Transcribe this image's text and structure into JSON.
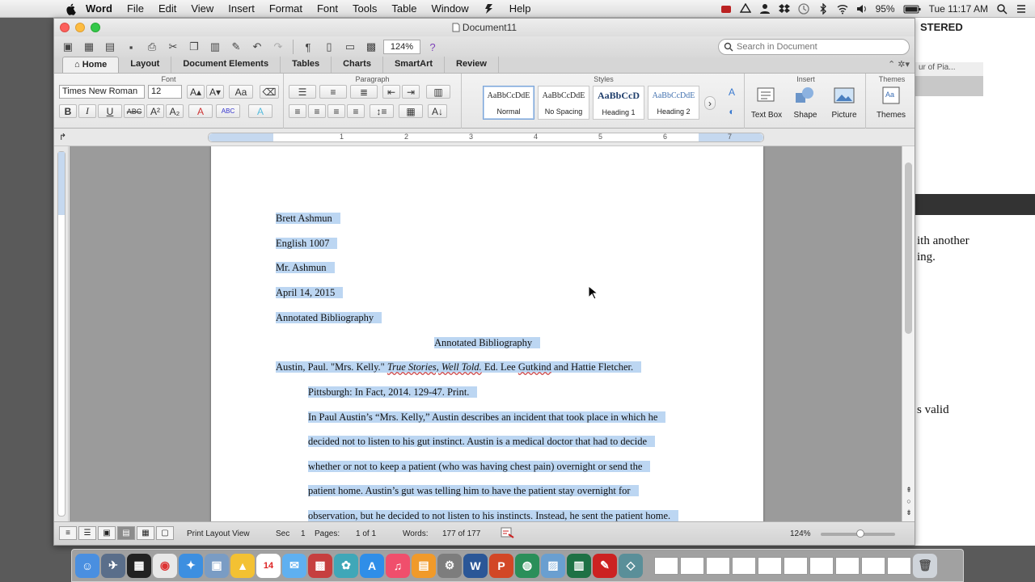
{
  "menubar": {
    "app": "Word",
    "items": [
      "File",
      "Edit",
      "View",
      "Insert",
      "Format",
      "Font",
      "Tools",
      "Table",
      "Window",
      "Help"
    ],
    "battery": "95%",
    "clock": "Tue 11:17 AM"
  },
  "window": {
    "title": "Document11"
  },
  "toolbar": {
    "zoom": "124%",
    "search_placeholder": "Search in Document"
  },
  "ribbon_tabs": [
    "Home",
    "Layout",
    "Document Elements",
    "Tables",
    "Charts",
    "SmartArt",
    "Review"
  ],
  "ribbon": {
    "font_group": "Font",
    "paragraph_group": "Paragraph",
    "styles_group": "Styles",
    "insert_group": "Insert",
    "themes_group": "Themes",
    "font_name": "Times New Roman",
    "font_size": "12",
    "styles": [
      {
        "preview": "AaBbCcDdE",
        "name": "Normal"
      },
      {
        "preview": "AaBbCcDdE",
        "name": "No Spacing"
      },
      {
        "preview": "AaBbCcD",
        "name": "Heading 1"
      },
      {
        "preview": "AaBbCcDdE",
        "name": "Heading 2"
      }
    ],
    "insert_items": [
      "Text Box",
      "Shape",
      "Picture"
    ],
    "themes_label": "Themes"
  },
  "ruler": {
    "numbers": [
      "1",
      "2",
      "3",
      "4",
      "5",
      "6",
      "7"
    ]
  },
  "document": {
    "lines": [
      "Brett Ashmun",
      "English 1007",
      "Mr. Ashmun",
      "April 14, 2015",
      "Annotated Bibliography",
      "Annotated Bibliography"
    ],
    "citation": {
      "author": "Austin, Paul. \"Mrs. Kelly.\" ",
      "book": "True Stories, Well Told.",
      "ed_prefix": " Ed. Lee ",
      "editor": "Gutkind",
      "ed_suffix": " and Hattie Fletcher.",
      "publisher": "Pittsburgh: In Fact, 2014. 129-47. Print."
    },
    "annotation": [
      "In Paul Austin’s “Mrs. Kelly,” Austin describes an incident that took place in which he",
      "decided not to listen to his gut instinct. Austin is a medical doctor that had to decide",
      "whether or not to keep a patient (who was having chest pain) overnight or send the",
      "patient home. Austin’s gut was telling him to have the patient stay overnight for",
      "observation, but he decided to not listen to his instincts. Instead, he sent the patient home."
    ]
  },
  "status": {
    "view": "Print Layout View",
    "sec_label": "Sec",
    "sec": "1",
    "pages_label": "Pages:",
    "pages": "1 of 1",
    "words_label": "Words:",
    "words": "177 of 177",
    "zoom": "124%"
  },
  "background_app": {
    "header": "STERED",
    "tab": "ur of Pia...",
    "text1": "ith another",
    "text2": "ing.",
    "text3": "s valid"
  }
}
